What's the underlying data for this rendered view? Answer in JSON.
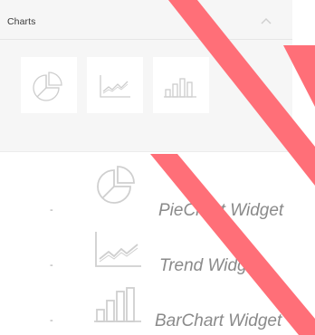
{
  "panel": {
    "title": "Charts",
    "collapse_icon": "chevron-up-icon",
    "tiles": [
      {
        "name": "pie-chart",
        "icon": "pie-chart-icon"
      },
      {
        "name": "trend",
        "icon": "line-chart-icon"
      },
      {
        "name": "bar-chart",
        "icon": "bar-chart-icon"
      }
    ]
  },
  "widgets": [
    {
      "dash": "-",
      "icon": "pie-chart-icon",
      "label": "PieChart Widget"
    },
    {
      "dash": "-",
      "icon": "line-chart-icon",
      "label": "Trend Widget"
    },
    {
      "dash": "-",
      "icon": "bar-chart-icon",
      "label": "BarChart Widget"
    }
  ],
  "colors": {
    "panel_bg": "#f6f6f6",
    "icon_stroke": "#d0d0d0",
    "label_text": "#8a8a8a",
    "stripe": "#ff6f78"
  }
}
